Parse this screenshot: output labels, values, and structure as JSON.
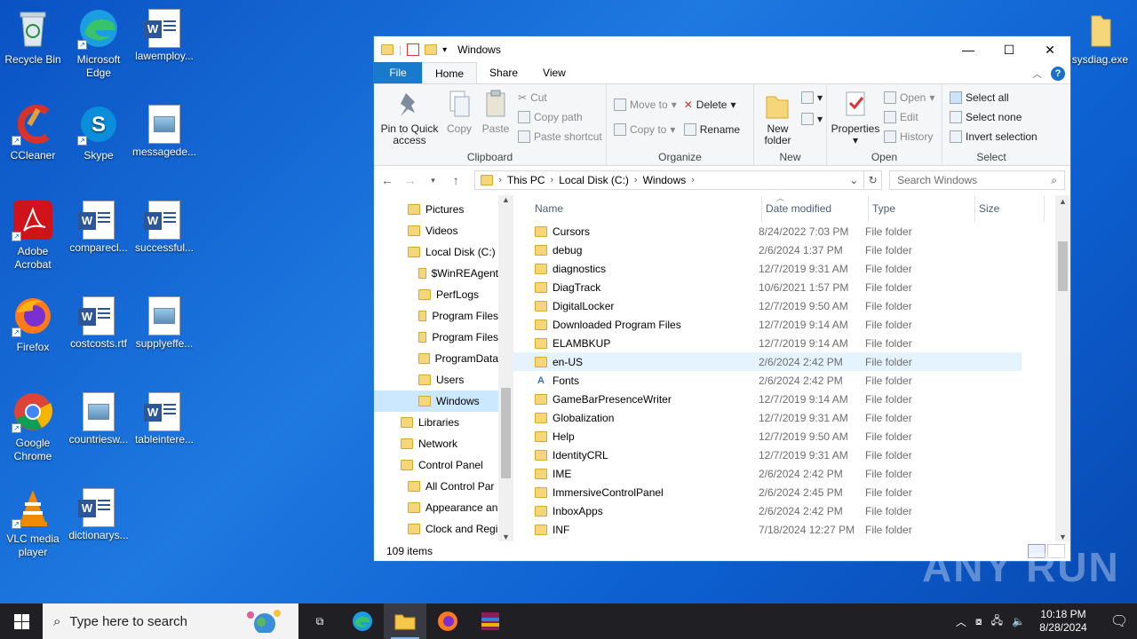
{
  "desktop": {
    "icons": [
      {
        "label": "Recycle Bin"
      },
      {
        "label": "Microsoft Edge"
      },
      {
        "label": "lawemploy..."
      },
      {
        "label": "CCleaner"
      },
      {
        "label": "Skype"
      },
      {
        "label": "messagede..."
      },
      {
        "label": "Adobe Acrobat"
      },
      {
        "label": "comparecl..."
      },
      {
        "label": "successful..."
      },
      {
        "label": "Firefox"
      },
      {
        "label": "costcosts.rtf"
      },
      {
        "label": "supplyeffe..."
      },
      {
        "label": "Google Chrome"
      },
      {
        "label": "countriesw..."
      },
      {
        "label": "tableintere..."
      },
      {
        "label": "VLC media player"
      },
      {
        "label": "dictionarys..."
      },
      {
        "label": "usysdiag.exe"
      }
    ]
  },
  "window": {
    "title": "Windows",
    "tabs": {
      "file": "File",
      "home": "Home",
      "share": "Share",
      "view": "View"
    },
    "ribbon": {
      "clipboard": {
        "name": "Clipboard",
        "pin": "Pin to Quick access",
        "copy": "Copy",
        "paste": "Paste",
        "cut": "Cut",
        "copy_path": "Copy path",
        "paste_shortcut": "Paste shortcut"
      },
      "organize": {
        "name": "Organize",
        "move_to": "Move to",
        "copy_to": "Copy to",
        "delete": "Delete",
        "rename": "Rename"
      },
      "new": {
        "name": "New",
        "new_folder": "New folder"
      },
      "open": {
        "name": "Open",
        "properties": "Properties",
        "open": "Open",
        "edit": "Edit",
        "history": "History"
      },
      "select": {
        "name": "Select",
        "select_all": "Select all",
        "select_none": "Select none",
        "invert": "Invert selection"
      }
    },
    "address": {
      "this_pc": "This PC",
      "local_disk": "Local Disk (C:)",
      "windows": "Windows"
    },
    "search_placeholder": "Search Windows",
    "nav": [
      {
        "label": "Pictures",
        "level": 1
      },
      {
        "label": "Videos",
        "level": 1
      },
      {
        "label": "Local Disk (C:)",
        "level": 1
      },
      {
        "label": "$WinREAgent",
        "level": 2
      },
      {
        "label": "PerfLogs",
        "level": 2
      },
      {
        "label": "Program Files",
        "level": 2
      },
      {
        "label": "Program Files",
        "level": 2
      },
      {
        "label": "ProgramData",
        "level": 2
      },
      {
        "label": "Users",
        "level": 2
      },
      {
        "label": "Windows",
        "level": 2,
        "selected": true
      },
      {
        "label": "Libraries",
        "level": 0
      },
      {
        "label": "Network",
        "level": 0
      },
      {
        "label": "Control Panel",
        "level": 0
      },
      {
        "label": "All Control Par",
        "level": 1
      },
      {
        "label": "Appearance an",
        "level": 1
      },
      {
        "label": "Clock and Regi",
        "level": 1
      }
    ],
    "columns": {
      "name": "Name",
      "date": "Date modified",
      "type": "Type",
      "size": "Size"
    },
    "files": [
      {
        "name": "Cursors",
        "date": "8/24/2022 7:03 PM",
        "type": "File folder"
      },
      {
        "name": "debug",
        "date": "2/6/2024 1:37 PM",
        "type": "File folder"
      },
      {
        "name": "diagnostics",
        "date": "12/7/2019 9:31 AM",
        "type": "File folder"
      },
      {
        "name": "DiagTrack",
        "date": "10/6/2021 1:57 PM",
        "type": "File folder"
      },
      {
        "name": "DigitalLocker",
        "date": "12/7/2019 9:50 AM",
        "type": "File folder"
      },
      {
        "name": "Downloaded Program Files",
        "date": "12/7/2019 9:14 AM",
        "type": "File folder"
      },
      {
        "name": "ELAMBKUP",
        "date": "12/7/2019 9:14 AM",
        "type": "File folder"
      },
      {
        "name": "en-US",
        "date": "2/6/2024 2:42 PM",
        "type": "File folder",
        "highlight": true
      },
      {
        "name": "Fonts",
        "date": "2/6/2024 2:42 PM",
        "type": "File folder",
        "fonts": true
      },
      {
        "name": "GameBarPresenceWriter",
        "date": "12/7/2019 9:14 AM",
        "type": "File folder"
      },
      {
        "name": "Globalization",
        "date": "12/7/2019 9:31 AM",
        "type": "File folder"
      },
      {
        "name": "Help",
        "date": "12/7/2019 9:50 AM",
        "type": "File folder"
      },
      {
        "name": "IdentityCRL",
        "date": "12/7/2019 9:31 AM",
        "type": "File folder"
      },
      {
        "name": "IME",
        "date": "2/6/2024 2:42 PM",
        "type": "File folder"
      },
      {
        "name": "ImmersiveControlPanel",
        "date": "2/6/2024 2:45 PM",
        "type": "File folder"
      },
      {
        "name": "InboxApps",
        "date": "2/6/2024 2:42 PM",
        "type": "File folder"
      },
      {
        "name": "INF",
        "date": "7/18/2024 12:27 PM",
        "type": "File folder"
      }
    ],
    "status": "109 items"
  },
  "taskbar": {
    "search_placeholder": "Type here to search",
    "time": "10:18 PM",
    "date": "8/28/2024"
  },
  "watermark": "ANY RUN"
}
